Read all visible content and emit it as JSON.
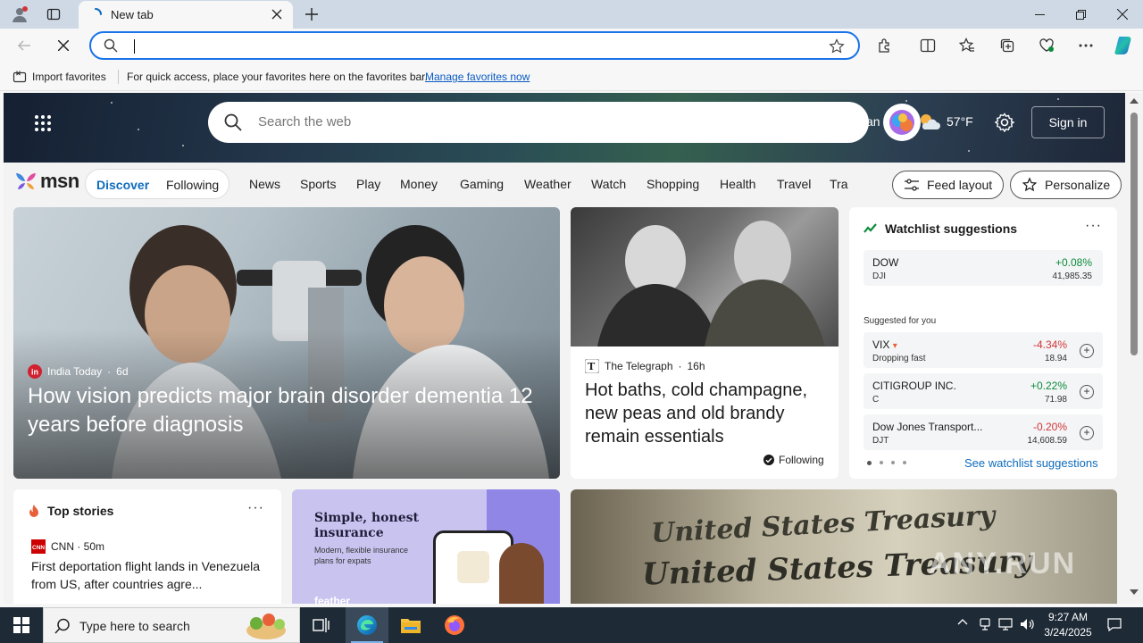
{
  "browser": {
    "tab_title": "New tab",
    "address_value": "",
    "favorites_bar": {
      "import_label": "Import favorites",
      "message": "For quick access, place your favorites here on the favorites bar.",
      "manage_link": "Manage favorites now"
    }
  },
  "msn": {
    "search_placeholder": "Search the web",
    "clipped_text": "an",
    "weather": "57°F",
    "sign_in": "Sign in",
    "logo": "msn",
    "pill": {
      "discover": "Discover",
      "following": "Following"
    },
    "categories": [
      "News",
      "Sports",
      "Play",
      "Money",
      "Gaming",
      "Weather",
      "Watch",
      "Shopping",
      "Health",
      "Travel",
      "Tra"
    ],
    "feed_layout": "Feed layout",
    "personalize": "Personalize"
  },
  "feature": {
    "source": "India Today",
    "age": "6d",
    "headline": "How vision predicts major brain disorder dementia 12 years before diagnosis"
  },
  "telegraph": {
    "source": "The Telegraph",
    "age": "16h",
    "headline": "Hot baths, cold champagne, new peas and old brandy remain essentials",
    "follow": "Following"
  },
  "watchlist": {
    "title": "Watchlist suggestions",
    "suggested_label": "Suggested for you",
    "see_link": "See watchlist suggestions",
    "main": {
      "name": "DOW",
      "symbol": "DJI",
      "change": "+0.08%",
      "price": "41,985.35",
      "direction": "up"
    },
    "suggestions": [
      {
        "name": "VIX",
        "symbol": "Dropping fast",
        "change": "-4.34%",
        "price": "18.94",
        "direction": "down"
      },
      {
        "name": "CITIGROUP INC.",
        "symbol": "C",
        "change": "+0.22%",
        "price": "71.98",
        "direction": "up"
      },
      {
        "name": "Dow Jones Transport...",
        "symbol": "DJT",
        "change": "-0.20%",
        "price": "14,608.59",
        "direction": "down"
      }
    ]
  },
  "top_stories": {
    "title": "Top stories",
    "source": "CNN · 50m",
    "headline": "First deportation flight lands in Venezuela from US, after countries agre..."
  },
  "ad": {
    "title": "Simple, honest insurance",
    "subtitle": "Modern, flexible insurance plans for expats",
    "brand": "feather"
  },
  "money_image": {
    "line1": "United States Treasury",
    "line2": "United States Treasury",
    "watermark": "ANY.RUN"
  },
  "taskbar": {
    "search_placeholder": "Type here to search",
    "time": "9:27 AM",
    "date": "3/24/2025"
  },
  "colors": {
    "accent": "#0f6cbd",
    "positive": "#0a8a3a",
    "negative": "#d13438",
    "taskbar": "#1e2a36"
  }
}
